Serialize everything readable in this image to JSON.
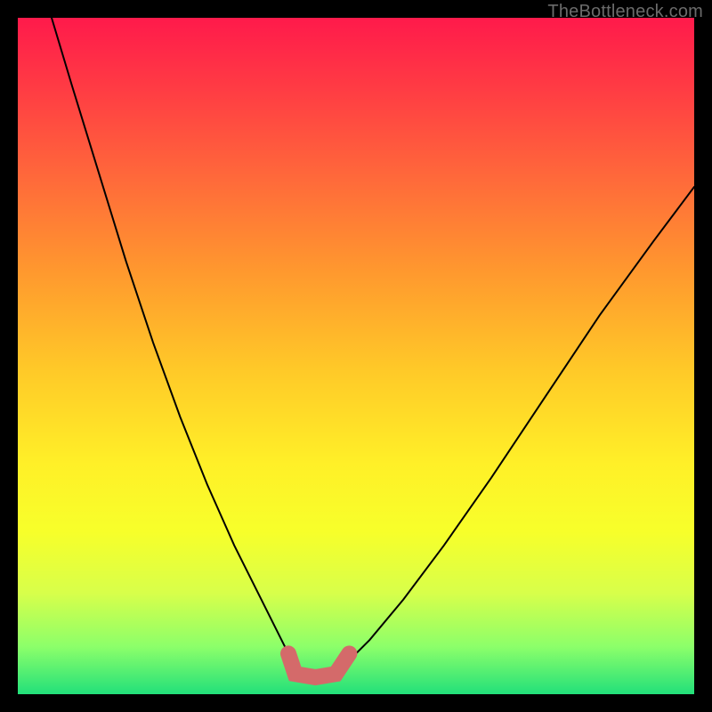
{
  "watermark": "TheBottleneck.com",
  "colors": {
    "curve": "#000000",
    "band": "#d46a6a",
    "gradient_top": "#ff1a4b",
    "gradient_mid": "#fff028",
    "gradient_bottom": "#22e07a",
    "frame": "#000000"
  },
  "chart_data": {
    "type": "line",
    "title": "",
    "xlabel": "",
    "ylabel": "",
    "xlim": [
      0,
      100
    ],
    "ylim": [
      0,
      100
    ],
    "grid": false,
    "legend": false,
    "series": [
      {
        "name": "left-curve",
        "x": [
          5,
          8,
          12,
          16,
          20,
          24,
          28,
          32,
          36,
          39,
          41
        ],
        "y": [
          100,
          90,
          77,
          64,
          52,
          41,
          31,
          22,
          14,
          8,
          4
        ]
      },
      {
        "name": "right-curve",
        "x": [
          48,
          52,
          57,
          63,
          70,
          78,
          86,
          94,
          100
        ],
        "y": [
          4,
          8,
          14,
          22,
          32,
          44,
          56,
          67,
          75
        ]
      },
      {
        "name": "optimal-flat-band",
        "x": [
          40,
          41,
          44,
          47,
          49
        ],
        "y": [
          6,
          3,
          2.5,
          3,
          6
        ]
      }
    ],
    "annotations": []
  }
}
